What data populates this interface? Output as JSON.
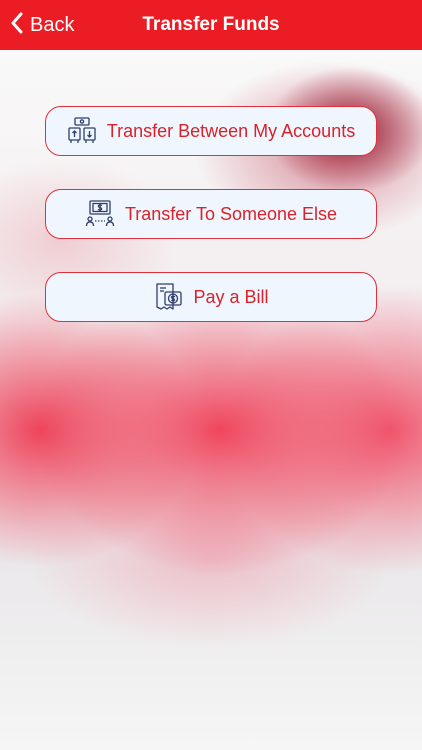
{
  "colors": {
    "nav_bg": "#ec1c24",
    "button_bg": "#f0f6fd",
    "button_border": "#e0303a",
    "button_text": "#d8222c",
    "icon": "#2f3d6b"
  },
  "nav": {
    "back_label": "Back",
    "title": "Transfer Funds",
    "back_icon": "chevron-left-icon"
  },
  "options": [
    {
      "label": "Transfer Between My Accounts",
      "icon": "account-transfer-icon"
    },
    {
      "label": "Transfer To Someone Else",
      "icon": "person-to-person-transfer-icon"
    },
    {
      "label": "Pay a Bill",
      "icon": "bill-payment-icon"
    }
  ]
}
